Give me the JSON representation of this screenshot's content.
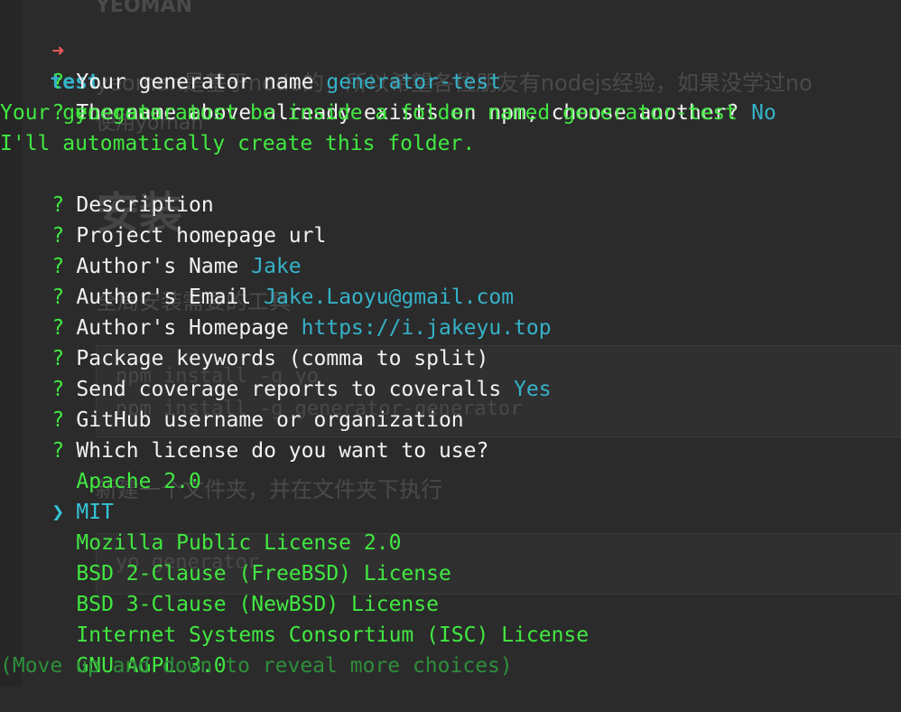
{
  "background": {
    "heading": "YEOMAN",
    "intro_line1": "yeoman是基于node的，所以希望各位朋友有nodejs经验，如果没学过no",
    "intro_line2": "使用yoman",
    "install_heading": "安装",
    "global_install_text": "全局安装需要的工具",
    "code_block1_line1": "npm install -g yo",
    "code_block1_line2": "npm install -g generator-generator",
    "new_folder_text": "新建一个文件夹，并在文件夹下执行",
    "code_block2_line1": "yo generator"
  },
  "terminal": {
    "prompt_arrow": "➜",
    "prompt_dir": "test",
    "prompt_cmd": "yo generator",
    "qmark": "?",
    "q1_label": "Your generator name",
    "q1_answer": "generator-test",
    "q2_label": "The name above already exists on npm, choose another?",
    "q2_answer": "No",
    "info1": "Your generator must be inside a folder named generator-test",
    "info2": "I'll automatically create this folder.",
    "q3_label": "Description",
    "q4_label": "Project homepage url",
    "q5_label": "Author's Name",
    "q5_answer": "Jake",
    "q6_label": "Author's Email",
    "q6_answer": "Jake.Laoyu@gmail.com",
    "q7_label": "Author's Homepage",
    "q7_answer": "https://i.jakeyu.top",
    "q8_label": "Package keywords (comma to split)",
    "q9_label": "Send coverage reports to coveralls",
    "q9_answer": "Yes",
    "q10_label": "GitHub username or organization",
    "q11_label": "Which license do you want to use?",
    "pointer": "❯",
    "license_options": [
      "Apache 2.0",
      "MIT",
      "Mozilla Public License 2.0",
      "BSD 2-Clause (FreeBSD) License",
      "BSD 3-Clause (NewBSD) License",
      "Internet Systems Consortium (ISC) License",
      "GNU AGPL 3.0"
    ],
    "selected_index": 1,
    "hint": "(Move up and down to reveal more choices)"
  },
  "colors": {
    "background": "#2b2b2b",
    "green": "#41e841",
    "cyan": "#35b2c8",
    "red_arrow": "#ef5a5a",
    "white": "#f2f2f2"
  }
}
